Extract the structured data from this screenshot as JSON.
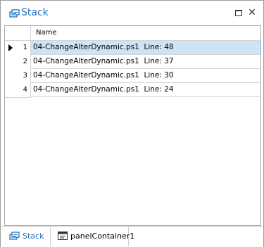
{
  "window": {
    "title": "Stack",
    "icon": "stack-icon",
    "controls": [
      "maximize-icon",
      "close-icon"
    ],
    "close_glyph": "✕",
    "accent_color": "#1f6fc6"
  },
  "grid": {
    "columns": [
      "Name"
    ],
    "selected_row_color": "#cfe3f5",
    "rows": [
      {
        "num": "1",
        "name": "04-ChangeAlterDynamic.ps1  Line: 48",
        "current": true
      },
      {
        "num": "2",
        "name": "04-ChangeAlterDynamic.ps1  Line: 37",
        "current": false
      },
      {
        "num": "3",
        "name": "04-ChangeAlterDynamic.ps1  Line: 30",
        "current": false
      },
      {
        "num": "4",
        "name": "04-ChangeAlterDynamic.ps1  Line: 24",
        "current": false
      }
    ]
  },
  "tabs": [
    {
      "label": "Stack",
      "icon": "stack-icon",
      "active": true
    },
    {
      "label": "panelContainer1",
      "icon": "panel-icon",
      "active": false
    }
  ]
}
